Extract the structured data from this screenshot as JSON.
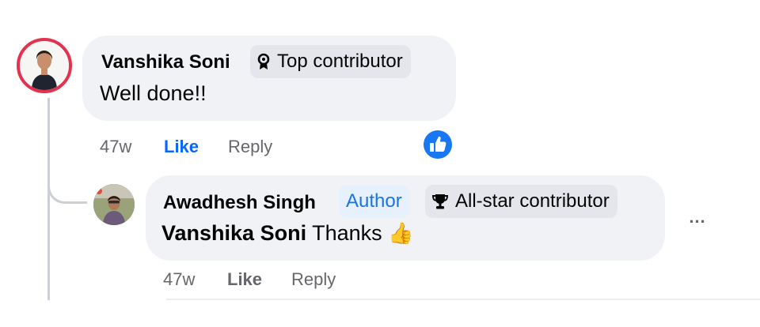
{
  "comment": {
    "author": "Vanshika Soni",
    "badge": "Top contributor",
    "badge_icon": "top-contributor-icon",
    "text": "Well done!!",
    "time": "47w",
    "like_label": "Like",
    "reply_label": "Reply",
    "reaction_icon": "like-reaction-icon",
    "colors": {
      "like_active": "#0866ff",
      "reaction_bg": "#1877f2"
    }
  },
  "reply": {
    "author": "Awadhesh Singh",
    "author_tag": "Author",
    "badge": "All-star contributor",
    "badge_icon": "trophy-icon",
    "mention": "Vanshika Soni",
    "text": " Thanks ",
    "emoji": "👍",
    "time": "47w",
    "like_label": "Like",
    "reply_label": "Reply",
    "more_label": "..."
  }
}
